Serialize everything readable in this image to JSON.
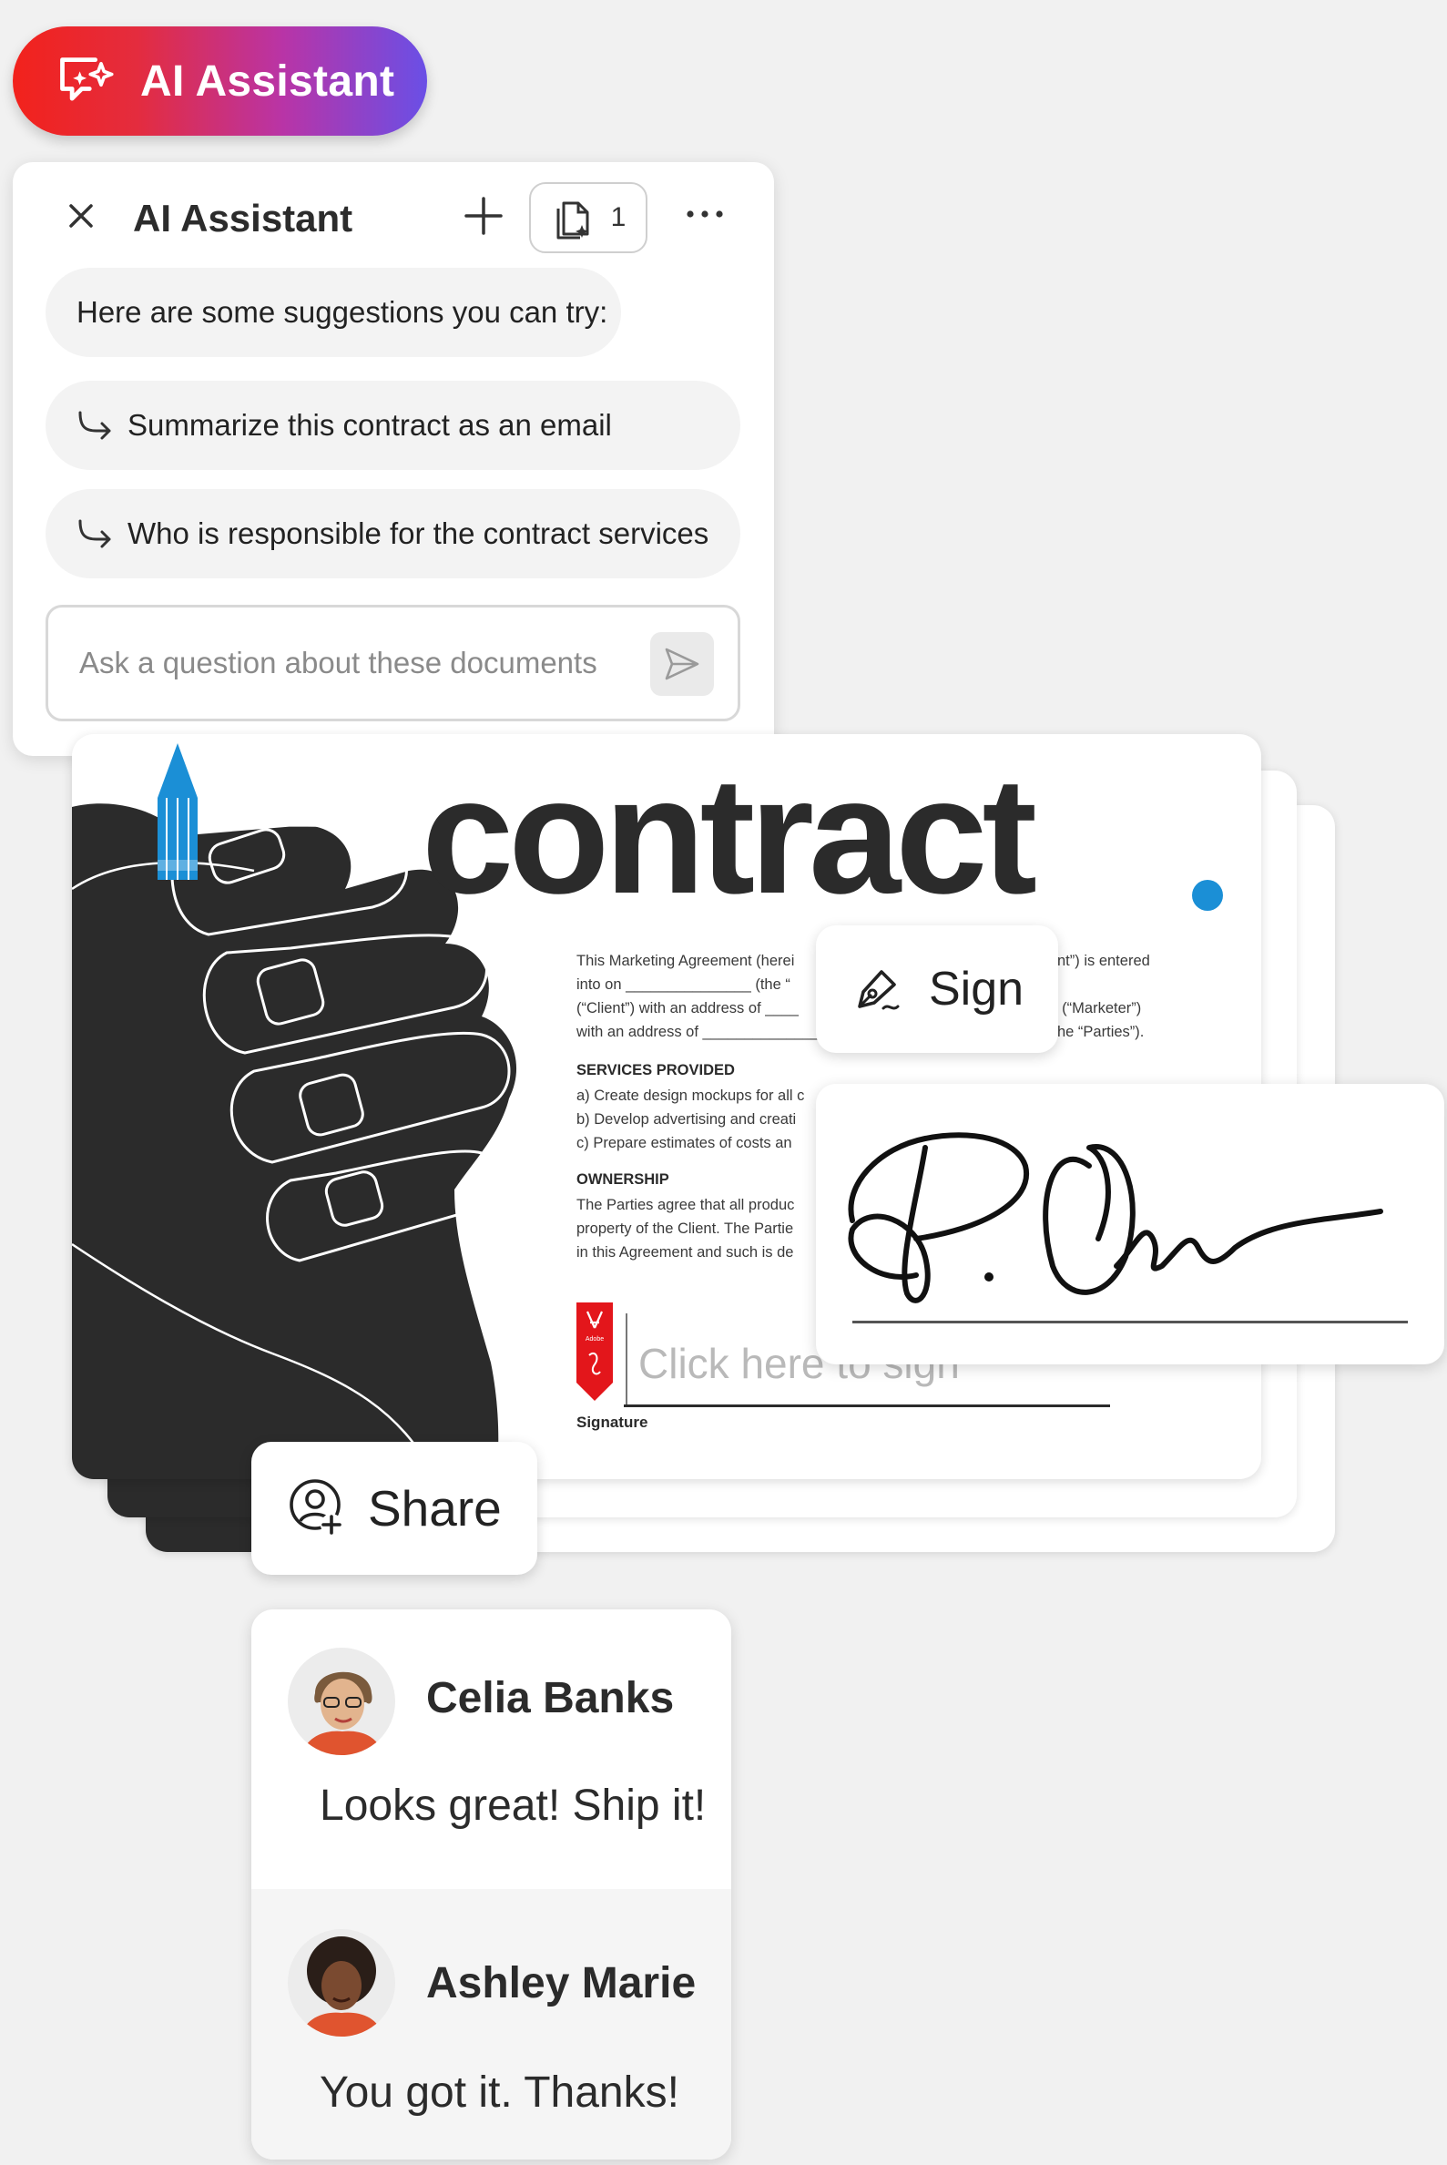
{
  "ai_pill": {
    "label": "AI Assistant"
  },
  "assistant_panel": {
    "title": "AI Assistant",
    "doc_count": "1",
    "suggestions_label": "Here are some suggestions you can try:",
    "suggestions": [
      "Summarize this contract as an email",
      "Who is responsible for the contract services"
    ],
    "input_placeholder": "Ask a question about these documents"
  },
  "contract": {
    "title": "contract",
    "intro_lines": [
      "This Marketing Agreement (herei",
      "into on _______________ (the “",
      "(“Client”) with an address of ____",
      "with an address of ______________"
    ],
    "intro_right_lines": [
      "nt”) is entered",
      "",
      "_________ (“Marketer”)",
      "he “Parties”)."
    ],
    "services_heading": "SERVICES PROVIDED",
    "services_lines": [
      "a) Create design mockups for all c",
      "b) Develop advertising and creati",
      "c) Prepare estimates of costs an"
    ],
    "ownership_heading": "OWNERSHIP",
    "ownership_lines": [
      "The Parties agree that all produc",
      "property of the Client. The Partie",
      "in this Agreement and such is de"
    ],
    "sign_placeholder": "Click here to sign",
    "signature_label": "Signature",
    "tab_text": "Adobe"
  },
  "sign_button": {
    "label": "Sign"
  },
  "share_button": {
    "label": "Share"
  },
  "comments": [
    {
      "name": "Celia Banks",
      "text": "Looks great! Ship it!"
    },
    {
      "name": "Ashley Marie",
      "text": "You got it. Thanks!"
    }
  ],
  "colors": {
    "gradient_start": "#f2221c",
    "gradient_end": "#6a4fe6",
    "contract_dot": "#1b8fd6",
    "pencil_blue": "#1b8fd6",
    "adobe_red": "#e3161b",
    "dark_art": "#2b2b2b"
  }
}
